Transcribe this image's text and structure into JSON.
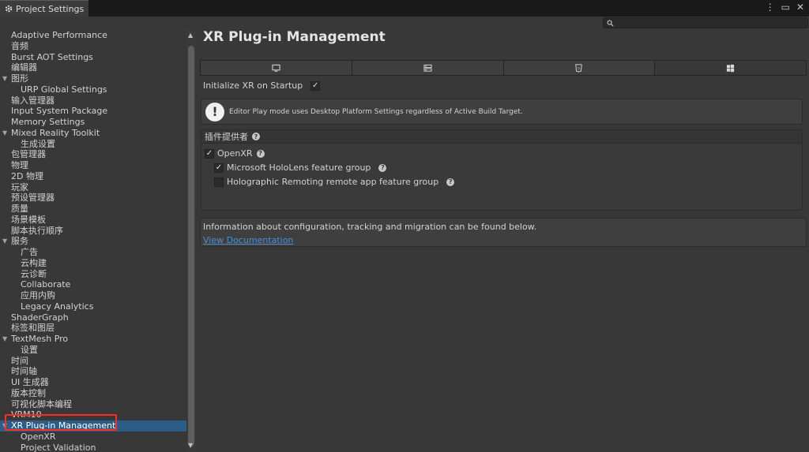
{
  "window": {
    "tab_title": "Project Settings",
    "icons": [
      "gear-icon",
      "more-icon",
      "maximize-icon",
      "close-icon"
    ]
  },
  "search": {
    "placeholder": ""
  },
  "sidebar": {
    "items": [
      {
        "label": "Adaptive Performance",
        "level": 0
      },
      {
        "label": "音频",
        "level": 0
      },
      {
        "label": "Burst AOT Settings",
        "level": 0
      },
      {
        "label": "编辑器",
        "level": 0
      },
      {
        "label": "图形",
        "level": 0,
        "foldout": true
      },
      {
        "label": "URP Global Settings",
        "level": 1
      },
      {
        "label": "输入管理器",
        "level": 0
      },
      {
        "label": "Input System Package",
        "level": 0
      },
      {
        "label": "Memory Settings",
        "level": 0
      },
      {
        "label": "Mixed Reality Toolkit",
        "level": 0,
        "foldout": true
      },
      {
        "label": "生成设置",
        "level": 1
      },
      {
        "label": "包管理器",
        "level": 0
      },
      {
        "label": "物理",
        "level": 0
      },
      {
        "label": "2D 物理",
        "level": 0
      },
      {
        "label": "玩家",
        "level": 0
      },
      {
        "label": "预设管理器",
        "level": 0
      },
      {
        "label": "质量",
        "level": 0
      },
      {
        "label": "场景模板",
        "level": 0
      },
      {
        "label": "脚本执行顺序",
        "level": 0
      },
      {
        "label": "服务",
        "level": 0,
        "foldout": true
      },
      {
        "label": "广告",
        "level": 1
      },
      {
        "label": "云构建",
        "level": 1
      },
      {
        "label": "云诊断",
        "level": 1
      },
      {
        "label": "Collaborate",
        "level": 1
      },
      {
        "label": "应用内购",
        "level": 1
      },
      {
        "label": "Legacy Analytics",
        "level": 1
      },
      {
        "label": "ShaderGraph",
        "level": 0
      },
      {
        "label": "标签和图层",
        "level": 0
      },
      {
        "label": "TextMesh Pro",
        "level": 0,
        "foldout": true
      },
      {
        "label": "设置",
        "level": 1
      },
      {
        "label": "时间",
        "level": 0
      },
      {
        "label": "时间轴",
        "level": 0
      },
      {
        "label": "UI 生成器",
        "level": 0
      },
      {
        "label": "版本控制",
        "level": 0
      },
      {
        "label": "可视化脚本编程",
        "level": 0
      },
      {
        "label": "VRM10",
        "level": 0
      },
      {
        "label": "XR Plug-in Management",
        "level": 0,
        "foldout": true,
        "selected": true
      },
      {
        "label": "OpenXR",
        "level": 1
      },
      {
        "label": "Project Validation",
        "level": 1
      }
    ]
  },
  "main": {
    "title": "XR Plug-in Management",
    "platform_tabs": [
      {
        "icon": "desktop-icon",
        "selected": false
      },
      {
        "icon": "server-icon",
        "selected": false
      },
      {
        "icon": "html5-icon",
        "selected": false
      },
      {
        "icon": "windows-icon",
        "selected": true
      }
    ],
    "init_label": "Initialize XR on Startup",
    "init_checked": true,
    "info_text": "Editor Play mode uses Desktop Platform Settings regardless of Active Build Target.",
    "providers_header": "插件提供者",
    "providers": [
      {
        "label": "OpenXR",
        "checked": true,
        "help": true
      },
      {
        "label": "Microsoft HoloLens feature group",
        "checked": true,
        "help": true
      },
      {
        "label": "Holographic Remoting remote app feature group",
        "checked": false,
        "help": true
      }
    ],
    "doc_text": "Information about configuration, tracking and migration can be found below.",
    "doc_link": "View Documentation"
  },
  "colors": {
    "background": "#383838",
    "selection": "#2c5d87",
    "link": "#4c8fd6",
    "highlight_box": "#ff2a2a"
  }
}
